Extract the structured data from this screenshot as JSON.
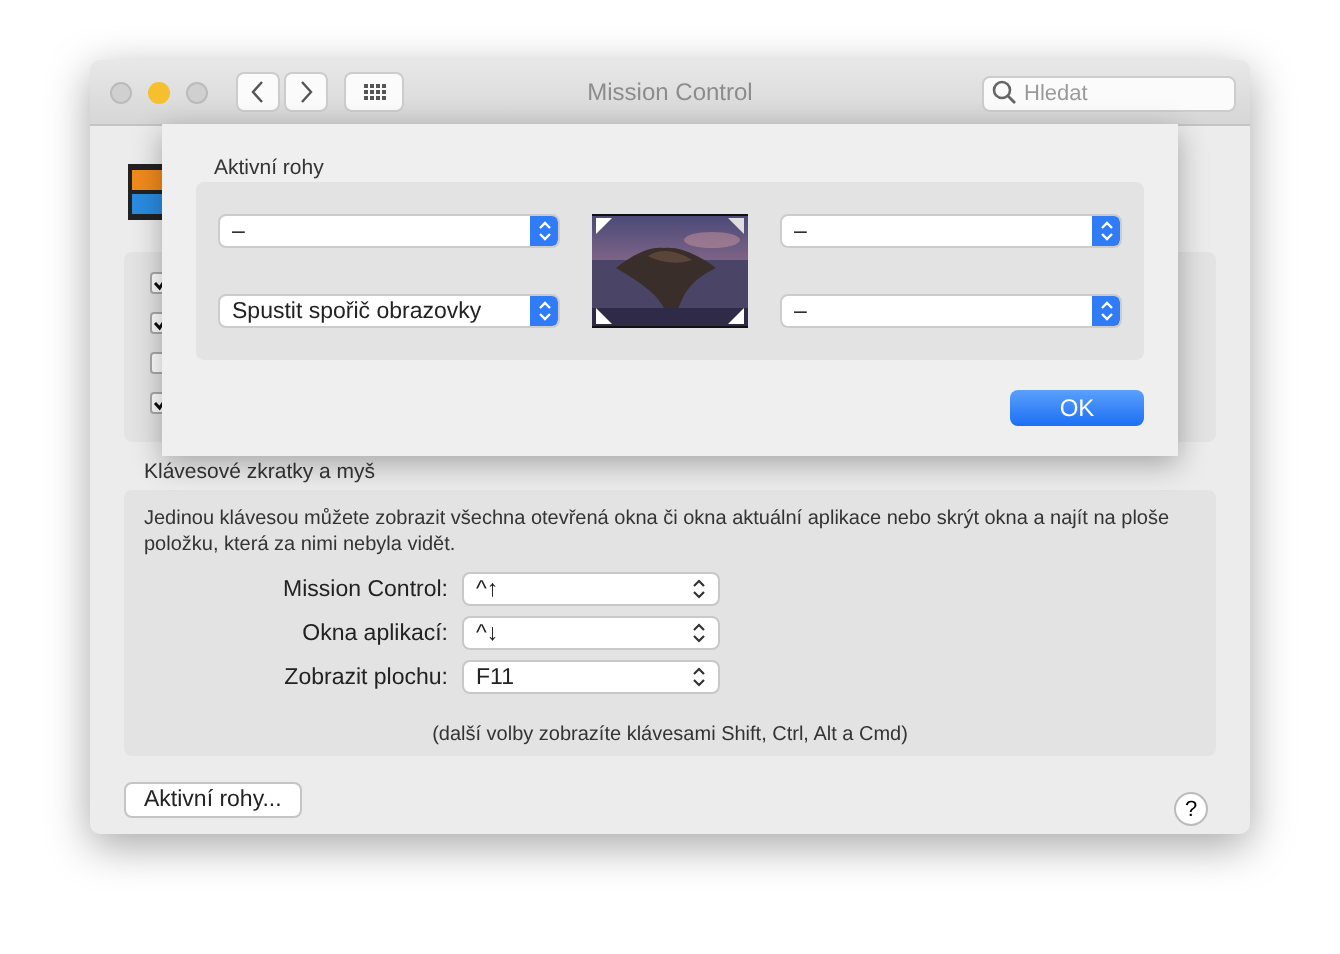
{
  "window": {
    "title": "Mission Control",
    "search": {
      "placeholder": "Hledat"
    }
  },
  "background_checkboxes": [
    {
      "checked": true
    },
    {
      "checked": true
    },
    {
      "checked": false
    },
    {
      "checked": true
    }
  ],
  "hot_corners_sheet": {
    "title": "Aktivní rohy",
    "corners": [
      {
        "value": "–"
      },
      {
        "value": "–"
      },
      {
        "value": "Spustit spořič obrazovky"
      },
      {
        "value": "–"
      }
    ],
    "ok_button": "OK"
  },
  "shortcuts": {
    "title": "Klávesové zkratky a myš",
    "description": "Jedinou klávesou můžete zobrazit všechna otevřená okna či okna aktuální aplikace nebo skrýt okna a najít na ploše položku, která za nimi nebyla vidět.",
    "rows": [
      {
        "label": "Mission Control:",
        "value": "^↑"
      },
      {
        "label": "Okna aplikací:",
        "value": "^↓"
      },
      {
        "label": "Zobrazit plochu:",
        "value": "F11"
      }
    ],
    "note": "(další volby zobrazíte klávesami Shift, Ctrl, Alt a Cmd)"
  },
  "hot_corners_button": "Aktivní rohy...",
  "help_button": "?"
}
